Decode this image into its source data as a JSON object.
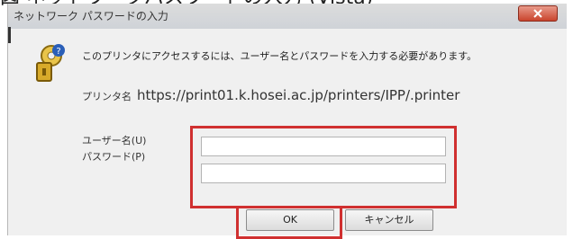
{
  "caption": "図 ネットワークパスワードの入力 (Vista)",
  "dialog": {
    "title": "ネットワーク パスワードの入力",
    "message": "このプリンタにアクセスするには、ユーザー名とパスワードを入力する必要があります。",
    "printer_label": "プリンタ名",
    "printer_url": "https://print01.k.hosei.ac.jp/printers/IPP/.printer",
    "username_label": "ユーザー名(U)",
    "password_label": "パスワード(P)",
    "username_value": "",
    "password_value": "",
    "ok_label": "OK",
    "cancel_label": "キャンセル"
  },
  "icons": [
    "key-icon",
    "question-icon",
    "close-icon"
  ],
  "colors": {
    "highlight": "#d03030",
    "dialog_bg": "#f0f0f0",
    "close_button": "#c9442d"
  }
}
